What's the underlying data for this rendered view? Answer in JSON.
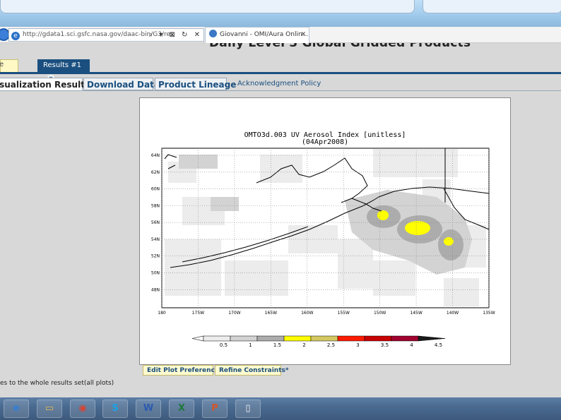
{
  "browser": {
    "address_url": "http://gdata1.sci.gsfc.nasa.gov/daac-bin/G3/res",
    "address_icons": "⌕ ▾ ⊠ ↻ ✕",
    "tab_title": "Giovanni - OMI/Aura Onlin...",
    "tab_close": "✕"
  },
  "page": {
    "heading": "Daily Level 3 Global Gridded Products"
  },
  "results_tabs": {
    "left_tab_label": "e",
    "results_tab_label": "Results #1",
    "close_glyph": "x"
  },
  "view_tabs": {
    "visualization": "isualization Results",
    "download": "Download Data",
    "lineage": "Product Lineage",
    "acknowledgment": "Acknowledgment Policy"
  },
  "plot": {
    "title_line1": "OMTO3d.003 UV Aerosol Index [unitless]",
    "title_line2": "(04Apr2008)",
    "lat_labels": [
      "64N",
      "62N",
      "60N",
      "58N",
      "56N",
      "54N",
      "52N",
      "50N",
      "48N"
    ],
    "lon_labels": [
      "180",
      "175W",
      "170W",
      "165W",
      "160W",
      "155W",
      "150W",
      "145W",
      "140W",
      "135W"
    ],
    "colorbar_labels": [
      "0.5",
      "1",
      "1.5",
      "2",
      "2.5",
      "3",
      "3.5",
      "4",
      "4.5"
    ],
    "colorbar_colors": [
      "#ececec",
      "#d3d3d3",
      "#acacac",
      "#ffff00",
      "#d3c860",
      "#ff1a00",
      "#c80000",
      "#a00030",
      "#1a1a1a"
    ]
  },
  "buttons": {
    "edit_prefs": "Edit Plot Preferences",
    "refine": "Refine Constraints*"
  },
  "footnote": "es to the whole results set(all plots)",
  "taskbar": {
    "icons": [
      {
        "name": "ie-icon",
        "glyph": "e",
        "color": "#2f7fd9"
      },
      {
        "name": "folder-icon",
        "glyph": "▭",
        "color": "#e6b84a"
      },
      {
        "name": "chrome-icon",
        "glyph": "◉",
        "color": "#d9422f"
      },
      {
        "name": "skype-icon",
        "glyph": "S",
        "color": "#1aa3e8"
      },
      {
        "name": "word-icon",
        "glyph": "W",
        "color": "#2b5bb0"
      },
      {
        "name": "excel-icon",
        "glyph": "X",
        "color": "#1f7a3a"
      },
      {
        "name": "powerpoint-icon",
        "glyph": "P",
        "color": "#d2552a"
      },
      {
        "name": "document-icon",
        "glyph": "▯",
        "color": "#f2f2f2"
      }
    ]
  }
}
